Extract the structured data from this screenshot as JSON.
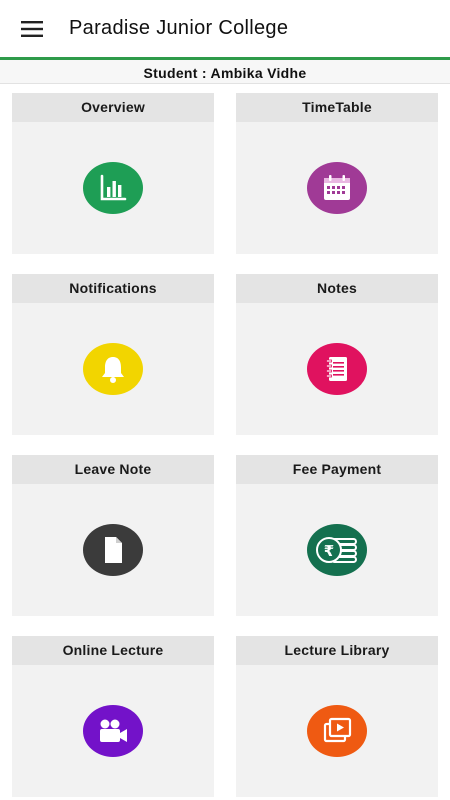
{
  "app": {
    "title": "Paradise Junior College"
  },
  "student_bar": {
    "text": "Student : Ambika Vidhe"
  },
  "colors": {
    "accent_green": "#2e9b4a",
    "overview": "#1e9e55",
    "timetable": "#a03a96",
    "notifications": "#f2d500",
    "notes": "#e0125f",
    "leave_note": "#3b3b3b",
    "fee_payment": "#14704f",
    "online_lecture": "#7312c9",
    "lecture_library": "#ef5a12"
  },
  "tiles": [
    {
      "label": "Overview",
      "icon": "bar-chart-icon"
    },
    {
      "label": "TimeTable",
      "icon": "calendar-icon"
    },
    {
      "label": "Notifications",
      "icon": "bell-icon"
    },
    {
      "label": "Notes",
      "icon": "notebook-icon"
    },
    {
      "label": "Leave Note",
      "icon": "document-icon"
    },
    {
      "label": "Fee Payment",
      "icon": "rupee-coins-icon"
    },
    {
      "label": "Online Lecture",
      "icon": "video-camera-icon"
    },
    {
      "label": "Lecture Library",
      "icon": "video-library-icon"
    }
  ]
}
